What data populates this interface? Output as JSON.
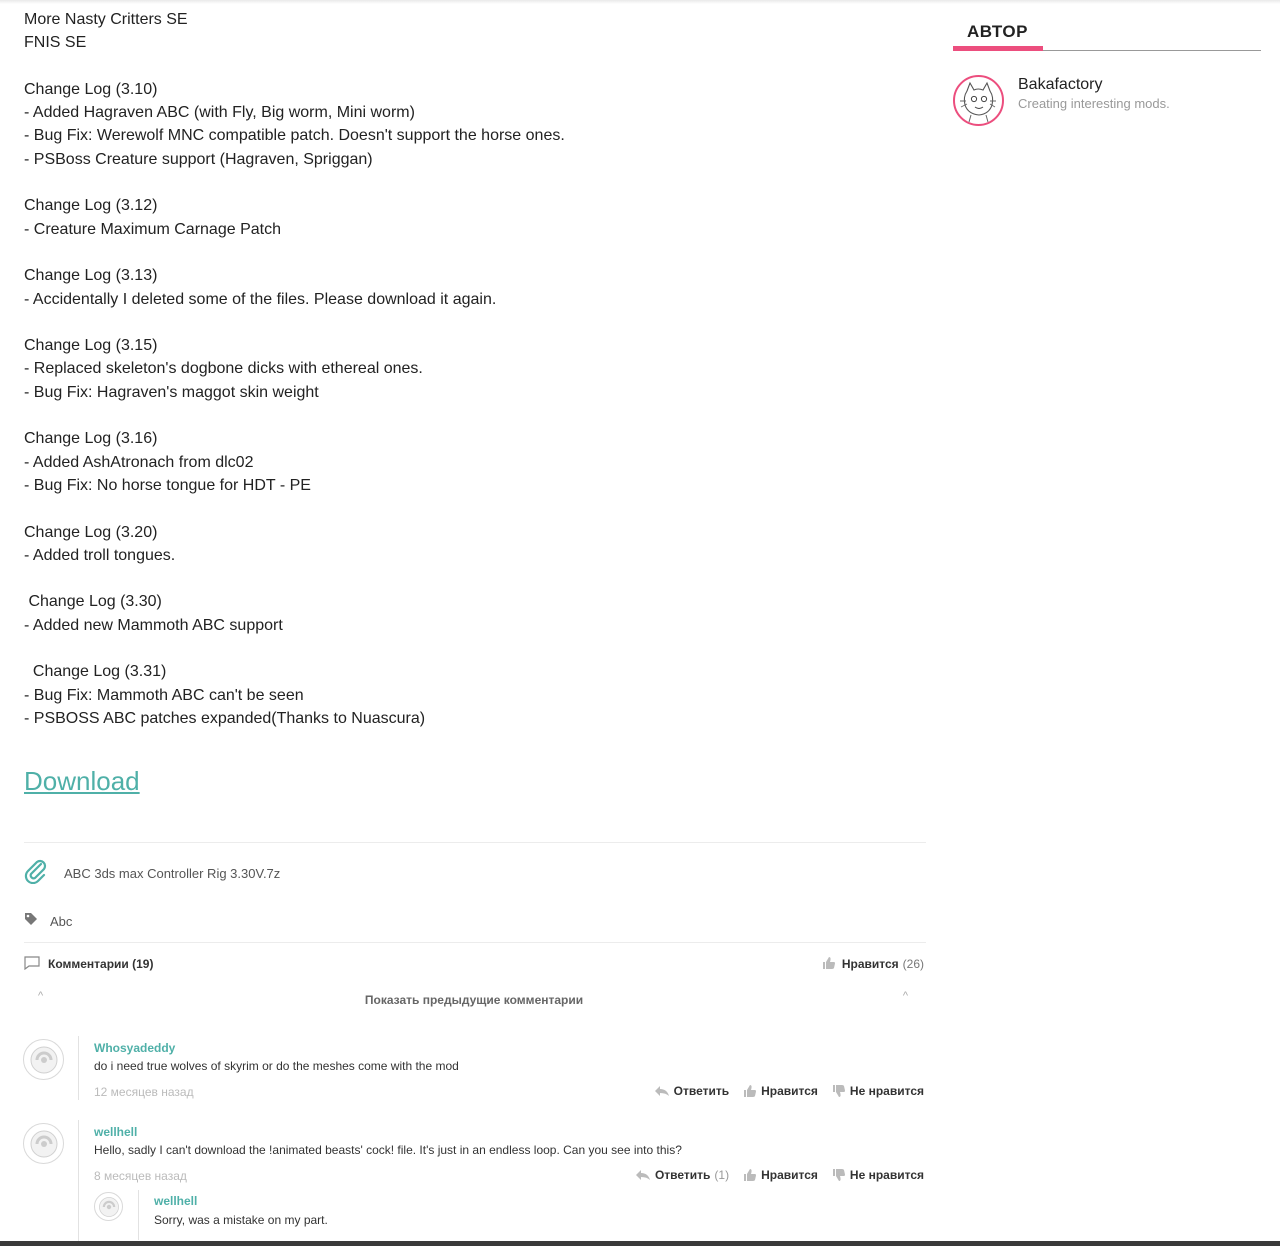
{
  "article": {
    "lines": [
      "More Nasty Critters SE",
      "FNIS SE",
      "",
      "Change Log (3.10)",
      "- Added Hagraven ABC (with Fly, Big worm, Mini worm)",
      "- Bug Fix: Werewolf MNC compatible patch. Doesn't support the horse ones.",
      "- PSBoss Creature support (Hagraven, Spriggan)",
      "",
      "Change Log (3.12)",
      "- Creature Maximum Carnage Patch",
      "",
      "Change Log (3.13)",
      "- Accidentally I deleted some of the files. Please download it again.",
      "",
      "Change Log (3.15)",
      "- Replaced skeleton's dogbone dicks with ethereal ones.",
      "- Bug Fix: Hagraven's maggot skin weight",
      "",
      "Change Log (3.16)",
      "- Added AshAtronach from dlc02",
      "- Bug Fix: No horse tongue for HDT - PE",
      "",
      "Change Log (3.20)",
      "- Added troll tongues.",
      "",
      " Change Log (3.30)",
      "- Added new Mammoth ABC support",
      "",
      "  Change Log (3.31)",
      "- Bug Fix: Mammoth ABC can't be seen",
      "- PSBOSS ABC patches expanded(Thanks to Nuascura)"
    ],
    "download_label": "Download"
  },
  "attachment": {
    "filename": "ABC 3ds max Controller Rig 3.30V.7z",
    "icon": "paperclip-icon"
  },
  "tags": {
    "icon": "tag-icon",
    "items": [
      "Abc"
    ]
  },
  "comments_bar": {
    "title": "Комментарии (19)",
    "likes_label": "Нравится",
    "likes_count": "(26)",
    "show_previous": "Показать предыдущие комментарии",
    "caret_left": "^",
    "caret_right": "^"
  },
  "comments": [
    {
      "author": "Whosyadeddy",
      "text": "do i need true wolves of skyrim or do the meshes come with the mod",
      "time": "12 месяцев назад",
      "reply_label": "Ответить",
      "reply_count": "",
      "like_label": "Нравится",
      "dislike_label": "Не нравится"
    },
    {
      "author": "wellhell",
      "text": "Hello, sadly I can't download the !animated beasts' cock! file. It's just in an endless loop. Can you see into this?",
      "time": "8 месяцев назад",
      "reply_label": "Ответить",
      "reply_count": "(1)",
      "like_label": "Нравится",
      "dislike_label": "Не нравится"
    },
    {
      "author": "wellhell",
      "text": "Sorry, was a mistake on my part."
    }
  ],
  "sidebar": {
    "title": "АВТОР",
    "author_name": "Bakafactory",
    "author_desc": "Creating interesting mods.",
    "accent_color": "#ec4e7e"
  },
  "colors": {
    "link": "#4fb0a8",
    "accent": "#ec4e7e"
  }
}
